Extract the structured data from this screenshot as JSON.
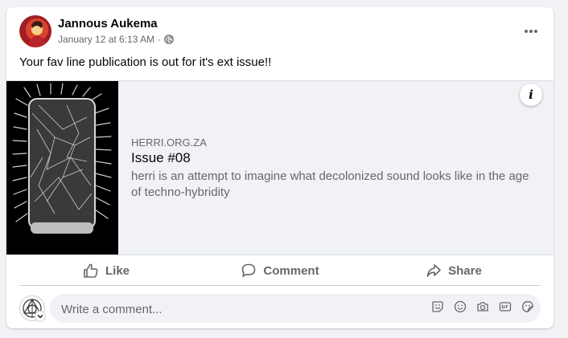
{
  "post": {
    "author": "Jannous Aukema",
    "timestamp": "January 12 at 6:13 AM",
    "separator": "·",
    "audience_icon": "globe-icon",
    "text": "Your fav line publication is out for it's ext issue!!"
  },
  "link": {
    "domain": "HERRI.ORG.ZA",
    "title": "Issue #08",
    "description": "herri is an attempt to imagine what decolonized sound looks like in the age of techno-hybridity",
    "info_glyph": "i"
  },
  "actions": {
    "like": "Like",
    "comment": "Comment",
    "share": "Share"
  },
  "composer": {
    "placeholder": "Write a comment...",
    "tools": [
      "emoji-sticker-icon",
      "smiley-icon",
      "camera-icon",
      "gif-icon",
      "sticker-icon"
    ]
  },
  "colors": {
    "text_primary": "#050505",
    "text_secondary": "#65676b",
    "background": "#f0f2f5"
  }
}
